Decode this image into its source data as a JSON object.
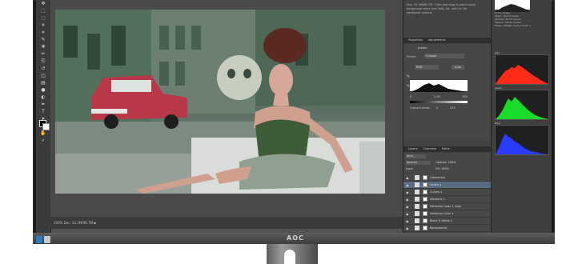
{
  "monitor": {
    "brand": "AOC"
  },
  "toolbar": {
    "tools": [
      "move-icon",
      "marquee-icon",
      "lasso-icon",
      "magic-wand-icon",
      "crop-icon",
      "eyedropper-icon",
      "healing-icon",
      "brush-icon",
      "stamp-icon",
      "history-brush-icon",
      "eraser-icon",
      "gradient-icon",
      "blur-icon",
      "dodge-icon",
      "pen-icon",
      "type-icon",
      "path-select-icon",
      "shape-icon",
      "hand-icon",
      "zoom-icon"
    ]
  },
  "document": {
    "status_text": "100%   Doc: 32.2M/96.7M  ▶"
  },
  "info_panel": {
    "text": "Doc: 32.2M/96.7M · Click and drag to paint using foreground color. Use Shift, Alt, and Ctrl for additional options."
  },
  "properties": {
    "tabs": [
      "Properties",
      "Adjustments"
    ],
    "title": "Levels",
    "preset_label": "Preset:",
    "preset_value": "Custom",
    "channel_value": "RGB",
    "auto_label": "Auto",
    "input_values": [
      "0",
      "1.00",
      "255"
    ],
    "output_label": "Output Levels:",
    "output_values": [
      "0",
      "255"
    ]
  },
  "layers": {
    "tabs": [
      "Layers",
      "Channels",
      "Paths"
    ],
    "kind_label": "Kind",
    "blend_mode": "Normal",
    "opacity": "Opacity: 100%",
    "fill": "Fill: 100%",
    "lock_label": "Lock:",
    "items": [
      {
        "name": "Glamorous"
      },
      {
        "name": "Levels 1"
      },
      {
        "name": "Curves 1"
      },
      {
        "name": "Vibrance 1"
      },
      {
        "name": "Selective Color 1 copy"
      },
      {
        "name": "Selective Color 1"
      },
      {
        "name": "Black & White 1"
      },
      {
        "name": "Background"
      }
    ]
  },
  "histogram": {
    "channel": "Entire Image",
    "info_lines": [
      "Mean: 101.53  Level:",
      "Std Dev: 62.47  Count:",
      "Median: 93  Percentile:",
      "Pixels: 295681  Cache Level: 1"
    ],
    "channels": [
      "Red",
      "Green",
      "Blue"
    ],
    "colors": {
      "red": "#ff2a1a",
      "green": "#1adb2a",
      "blue": "#2a3aff"
    }
  }
}
